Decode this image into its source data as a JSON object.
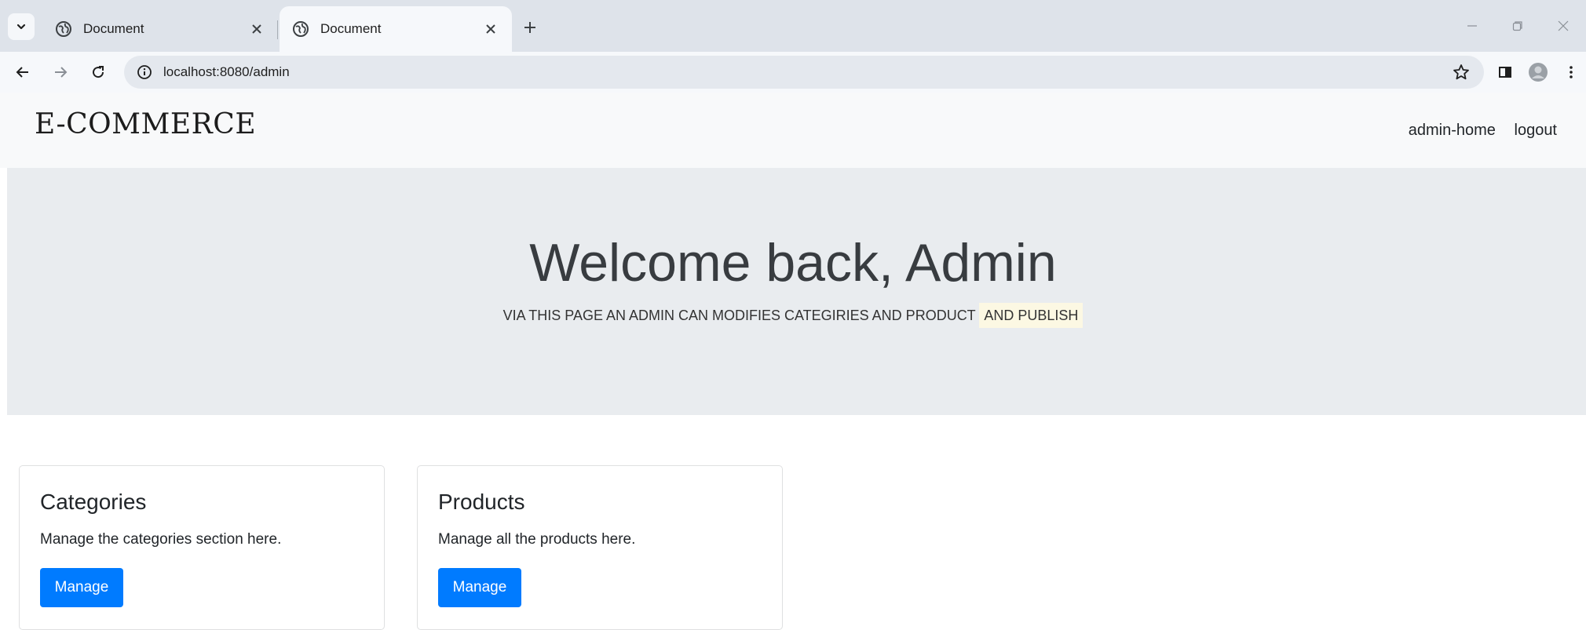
{
  "browser": {
    "tabs": [
      {
        "title": "Document",
        "active": false
      },
      {
        "title": "Document",
        "active": true
      }
    ],
    "url": "localhost:8080/admin"
  },
  "navbar": {
    "brand": "E-COMMERCE",
    "links": [
      "admin-home",
      "logout"
    ]
  },
  "hero": {
    "title": "Welcome back, Admin",
    "lead_prefix": "VIA THIS PAGE AN ADMIN CAN MODIFIES CATEGIRIES AND PRODUCT",
    "lead_highlight": "AND PUBLISH"
  },
  "cards": [
    {
      "title": "Categories",
      "text": "Manage the categories section here.",
      "button": "Manage"
    },
    {
      "title": "Products",
      "text": "Manage all the products here.",
      "button": "Manage"
    }
  ],
  "colors": {
    "primary_button": "#007bff",
    "jumbotron_bg": "#e9ecef",
    "navbar_bg": "#f8f9fa",
    "highlight": "#fcf8e3"
  }
}
